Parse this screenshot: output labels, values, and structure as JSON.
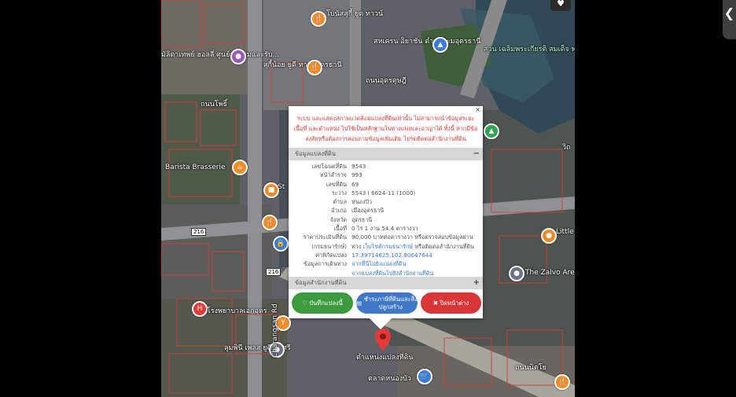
{
  "favorite_icon": "heart-icon",
  "side_toggle_icon": "chevron-left-icon",
  "map": {
    "labels": {
      "place_top": "โบนัสสุกี้ ยูด ทาวน์",
      "fire": "สหเครน อิยาชัน ตำนประมอุดรธานี",
      "park": "สวน เฉลิมพระเกียรติ สมเด็จ พระนางเจ้า...",
      "shop_left": "มัลิตาเทพย์ ฮอลลี่ ศูนย์ประชุมและรับ...",
      "suki": "สุกี้น้อย ยูดี ทาวน์อุดรธานี",
      "road_vertical": "ถนนโพศรี",
      "road_diag1": "ถนนอุดรดุษฎี",
      "road_diag2": "ถนนโพธิ์",
      "barista": "Barista Brasserie",
      "vithi": "วิถ",
      "station": "St",
      "little": "Little comm",
      "zalvo": "The Zalvo Are",
      "hospital": "โรงพยาบาลเอกอุดร",
      "lumphini": "ลุมพินี เพลส ยูดี โพศรี",
      "road_sangsan": "Charangsan Rd",
      "market": "ตลาดหนองบัว",
      "parcel_pin": "ตำแหน่งแปลงที่ดิน",
      "road_bottom": "ถนนนิตโย",
      "sign1": "216",
      "sign2": "216",
      "sign3": "216"
    }
  },
  "popup": {
    "close_label": "×",
    "notice": "ระบบ และแสดงสภาพแวดล้อมแปลงที่ดินเท่านั้น ไม่สามารถนำข้อมูลระยะ เนื้อที่ และตำแหน่ง ไปใช้เป็นหลักฐานในทางแพ่งและอาญาได้ ทั้งนี้ หากมีข้อสงสัยหรือต้องการสอบถามข้อมูลเพิ่มเติม โปรดติดต่อสำนักงานที่ดิน",
    "section1_title": "ข้อมูลแปลงที่ดิน",
    "section1_sign": "−",
    "rows": [
      {
        "k": "เลขโฉนดที่ดิน",
        "v": "9543"
      },
      {
        "k": "หน้าสำรวจ",
        "v": "993"
      },
      {
        "k": "เลขที่ดิน",
        "v": "69"
      },
      {
        "k": "ระวาง",
        "v": "5543 I 6624-11 (1000)"
      },
      {
        "k": "ตำบล",
        "v": "หนองบัว"
      },
      {
        "k": "อำเภอ",
        "v": "เมืองอุดรธานี"
      },
      {
        "k": "จังหวัด",
        "v": "อุดรธานี"
      },
      {
        "k": "เนื้อที่",
        "v": "0 ไร่ 1 งาน 54.4 ตารางวา"
      }
    ],
    "price_label": "ราคาประเมินที่ดิน",
    "price_value": "90,000 บาทต่อตารางวา หรือตรวจสอบข้อมูลผ่าน",
    "price_label2": "(กรมธนารักษ์)",
    "price_value2_pre": "ทาง",
    "price_value2_link": "เว็บไซต์กรมธนารักษ์",
    "price_value2_post": "หรือติดต่อสำนักงานที่ดิน",
    "coord_label": "ค่าพิกัดแปลง",
    "coord_value": "17.39714625,102.80647644",
    "travel_label": "ข้อมูลการเดินทาง",
    "travel_link1": "จากที่นี่ไปยังแปลงที่ดิน",
    "travel_link2": "จากแปลงที่ดินไปยังสำนักงานที่ดิน",
    "section2_title": "ข้อมูลสำนักงานที่ดิน",
    "section2_sign": "+",
    "buttons": {
      "save": "บันทึกแปลงนี้",
      "pay": "ชำระภาษีที่ดินและสิ่งปลูกสร้าง",
      "close": "ปิดหน้าต่าง"
    }
  }
}
